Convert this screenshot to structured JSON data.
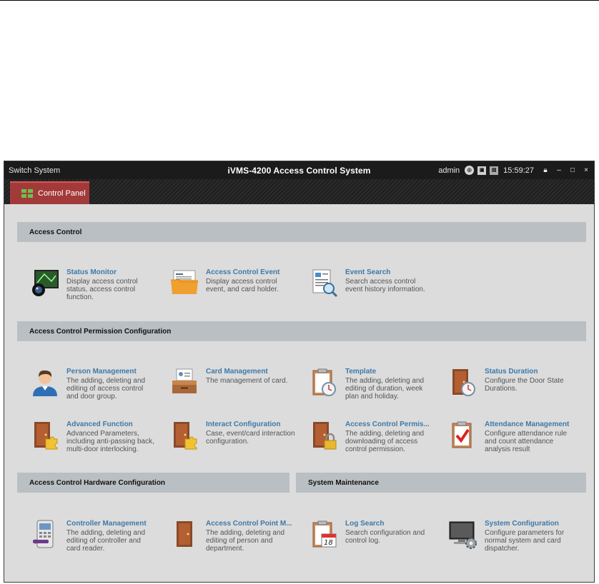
{
  "titlebar": {
    "switch_system": "Switch System",
    "app_title": "iVMS-4200  Access Control System",
    "user": "admin",
    "time": "15:59:27",
    "icons": [
      "globe-icon",
      "cpu-icon",
      "ram-icon",
      "lock-icon",
      "minimize-icon",
      "maximize-icon",
      "close-icon"
    ]
  },
  "tab": {
    "label": "Control Panel"
  },
  "sections": {
    "access_control": "Access Control",
    "permission": "Access Control Permission Configuration",
    "hardware": "Access Control Hardware Configuration",
    "maintenance": "System Maintenance"
  },
  "items": {
    "status_monitor": {
      "title": "Status Monitor",
      "desc": "Display access control status, access control function."
    },
    "access_control_event": {
      "title": "Access Control Event",
      "desc": "Display access control event, and card holder."
    },
    "event_search": {
      "title": "Event Search",
      "desc": "Search access control event history information."
    },
    "person_management": {
      "title": "Person Management",
      "desc": "The adding, deleting and editing of access control and door group."
    },
    "card_management": {
      "title": "Card Management",
      "desc": "The management of card."
    },
    "template": {
      "title": "Template",
      "desc": "The adding, deleting and editing of duration, week plan and holiday."
    },
    "status_duration": {
      "title": "Status Duration",
      "desc": "Configure the Door State Durations."
    },
    "advanced_function": {
      "title": "Advanced Function",
      "desc": "Advanced Parameters, including anti-passing back, multi-door interlocking."
    },
    "interact_configuration": {
      "title": "Interact Configuration",
      "desc": "Case, event/card interaction configuration."
    },
    "access_control_permission": {
      "title": "Access Control Permis...",
      "desc": "The adding, deleting and downloading of access control permission."
    },
    "attendance_management": {
      "title": "Attendance Management",
      "desc": "Configure attendance rule and count attendance analysis result"
    },
    "controller_management": {
      "title": "Controller Management",
      "desc": "The adding, deleting and editing of controller and card reader."
    },
    "access_control_point": {
      "title": "Access Control Point M...",
      "desc": "The adding, deleting and editing of person and department."
    },
    "log_search": {
      "title": "Log Search",
      "desc": "Search configuration and control log."
    },
    "system_configuration": {
      "title": "System Configuration",
      "desc": "Configure parameters for normal system and card dispatcher."
    }
  },
  "colors": {
    "titlebar_bg": "#1b1b1b",
    "tab_bg": "#a33a3a",
    "content_bg": "#dcdcdc",
    "section_bg": "#b9bfc3",
    "link_title": "#3f79a8"
  }
}
